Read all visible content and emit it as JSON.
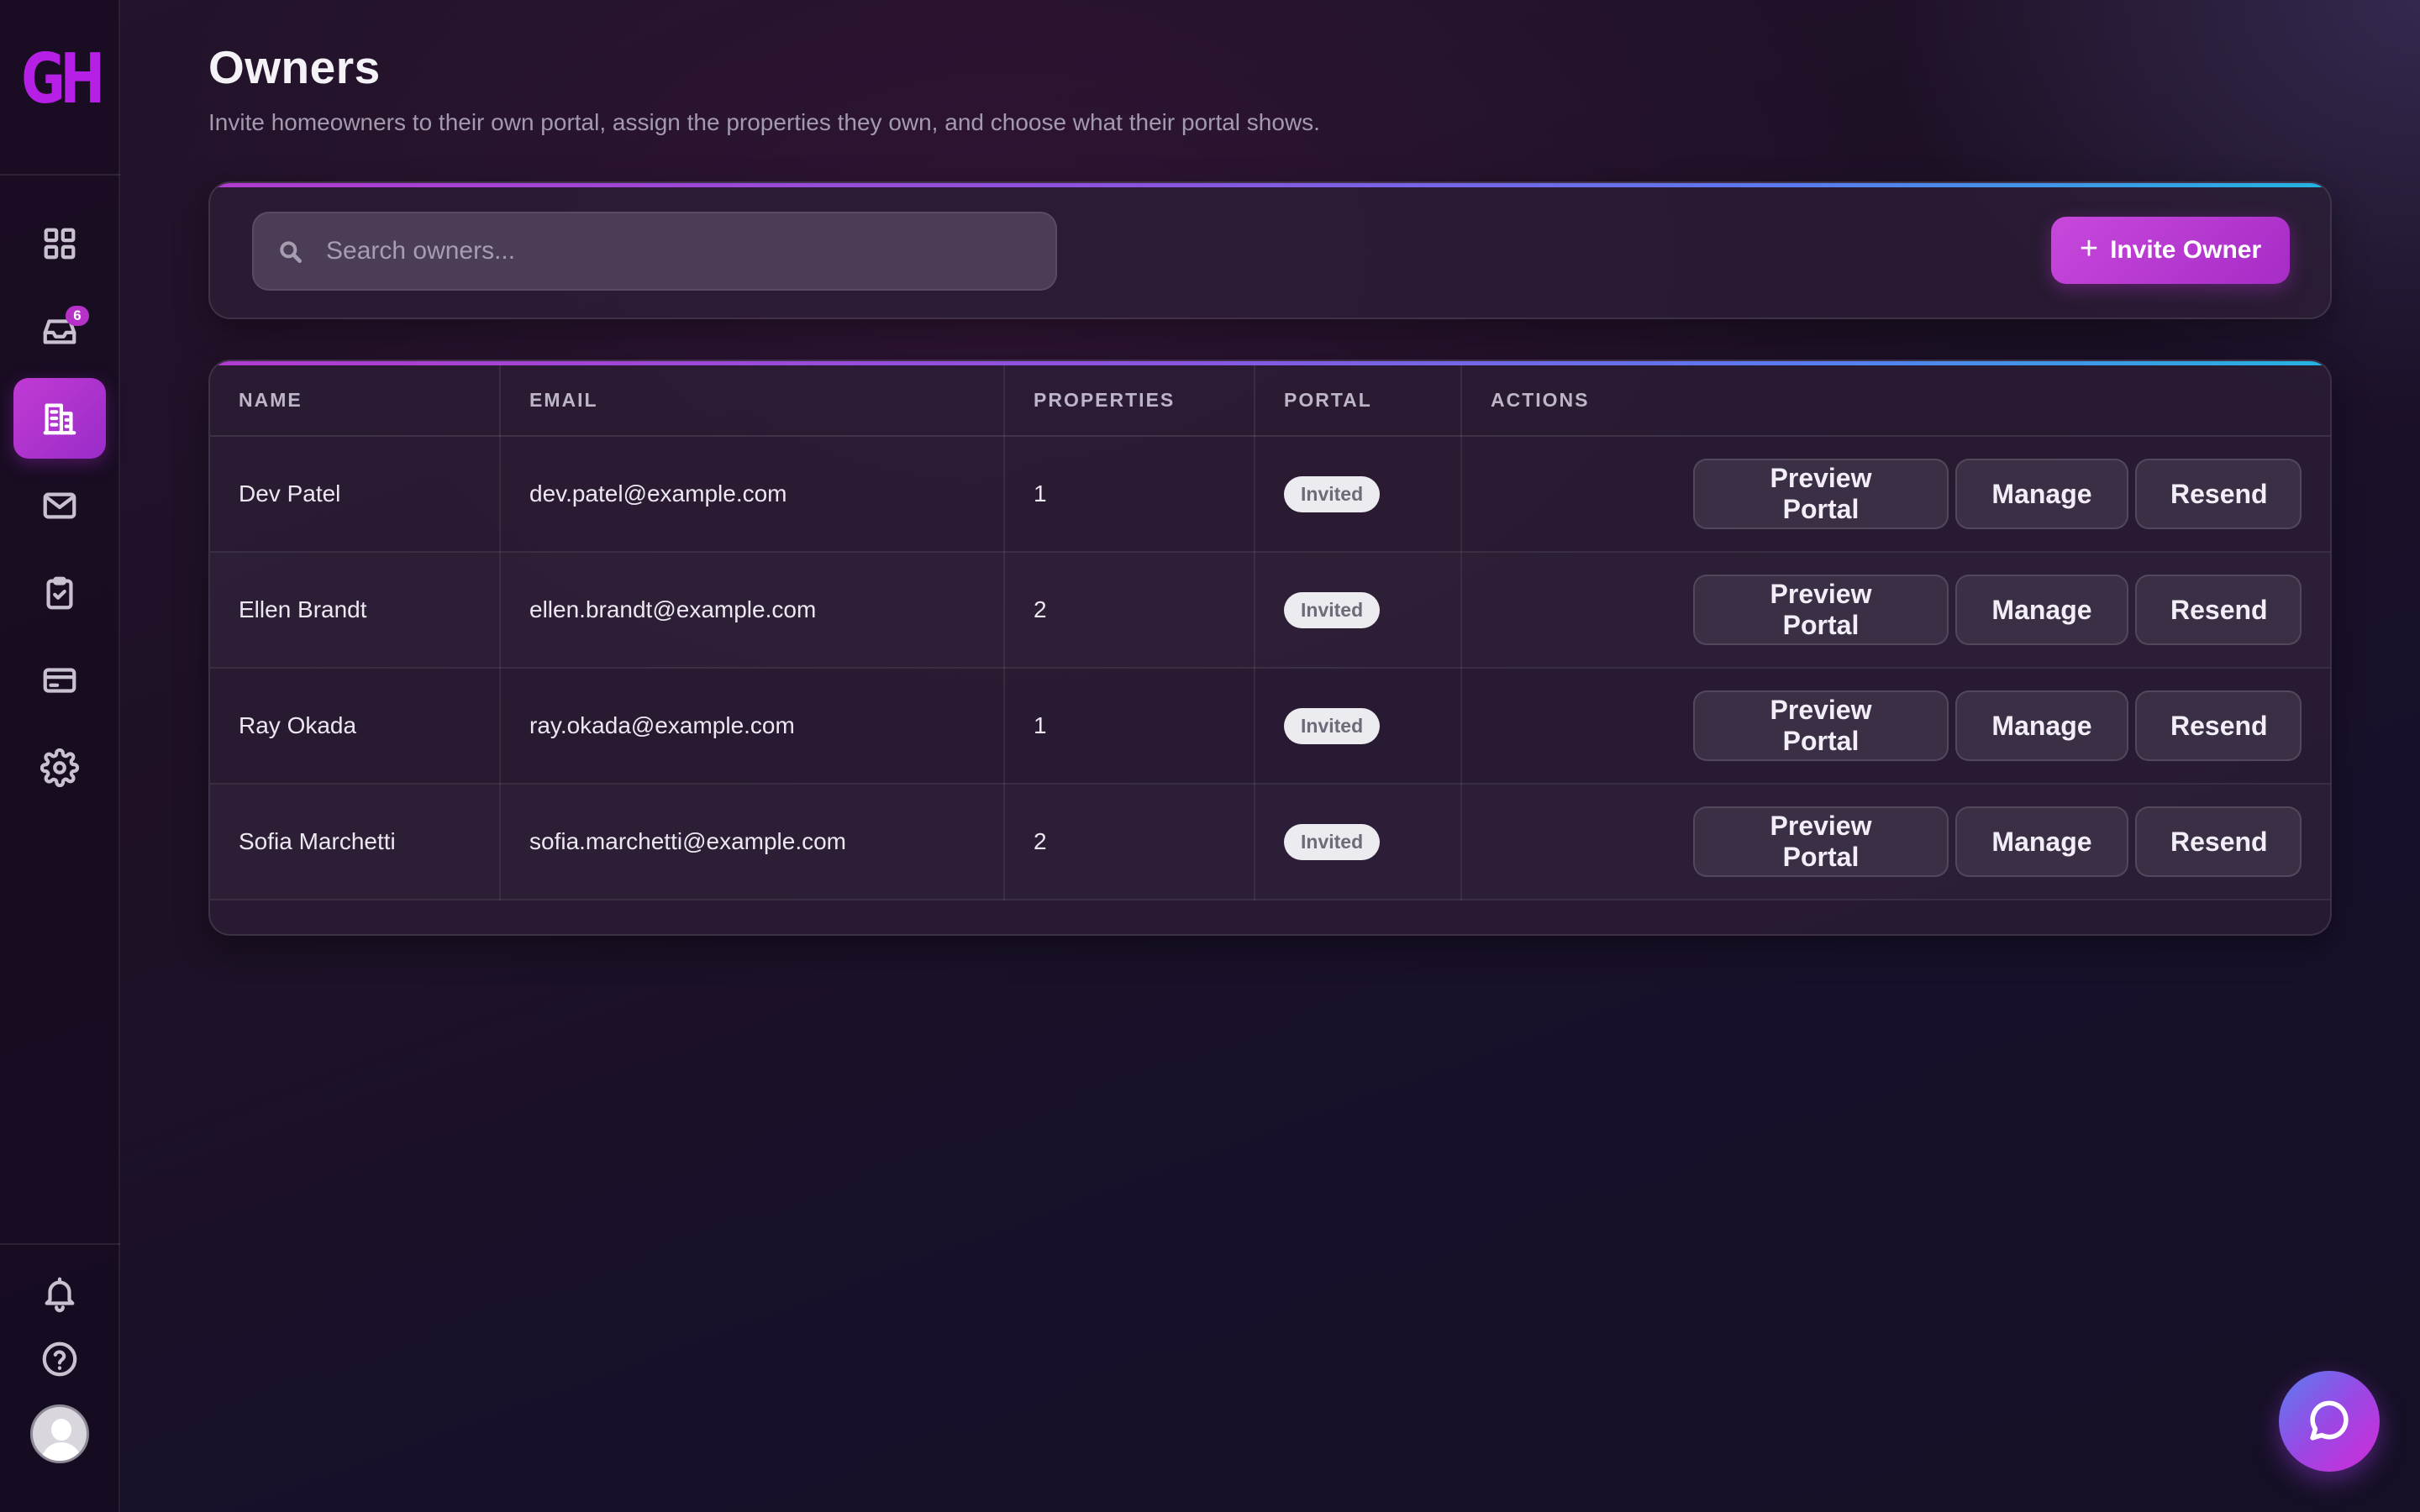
{
  "app": {
    "logo_text": "GH",
    "brand_color": "#b51fe6",
    "accent_color": "#c13ad4"
  },
  "sidebar": {
    "nav_items": [
      {
        "id": "dashboard",
        "icon": "grid-icon",
        "active": false
      },
      {
        "id": "inbox",
        "icon": "inbox-tray-icon",
        "active": false,
        "badge": "6"
      },
      {
        "id": "properties",
        "icon": "building-icon",
        "active": true
      },
      {
        "id": "messages",
        "icon": "mail-icon",
        "active": false
      },
      {
        "id": "tasks",
        "icon": "clipboard-check-icon",
        "active": false
      },
      {
        "id": "billing",
        "icon": "credit-card-icon",
        "active": false
      },
      {
        "id": "settings",
        "icon": "gear-icon",
        "active": false
      }
    ],
    "bottom_items": [
      {
        "id": "notifications",
        "icon": "bell-icon"
      },
      {
        "id": "help",
        "icon": "question-circle-icon"
      },
      {
        "id": "profile",
        "icon": "user-avatar"
      }
    ]
  },
  "header": {
    "title": "Owners",
    "subtitle": "Invite homeowners to their own portal, assign the properties they own, and choose what their portal shows."
  },
  "toolbar": {
    "search_placeholder": "Search owners...",
    "search_value": "",
    "invite_label": "Invite Owner"
  },
  "table": {
    "columns": [
      "NAME",
      "EMAIL",
      "PROPERTIES",
      "PORTAL",
      "ACTIONS"
    ],
    "rows": [
      {
        "name": "Dev Patel",
        "email": "dev.patel@example.com",
        "properties": "1",
        "portal": "Invited"
      },
      {
        "name": "Ellen Brandt",
        "email": "ellen.brandt@example.com",
        "properties": "2",
        "portal": "Invited"
      },
      {
        "name": "Ray Okada",
        "email": "ray.okada@example.com",
        "properties": "1",
        "portal": "Invited"
      },
      {
        "name": "Sofia Marchetti",
        "email": "sofia.marchetti@example.com",
        "properties": "2",
        "portal": "Invited"
      }
    ],
    "action_labels": {
      "preview": "Preview Portal",
      "manage": "Manage",
      "resend": "Resend"
    }
  },
  "chat": {
    "icon": "chat-bubble-icon"
  }
}
